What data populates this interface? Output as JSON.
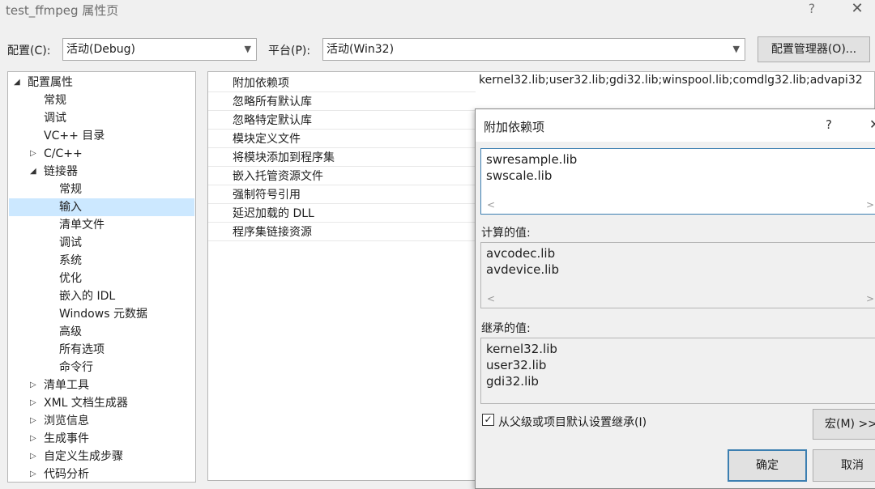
{
  "window": {
    "title": "test_ffmpeg 属性页",
    "help": "?",
    "close": "✕"
  },
  "toolbar": {
    "config_label": "配置(C):",
    "config_value": "活动(Debug)",
    "platform_label": "平台(P):",
    "platform_value": "活动(Win32)",
    "config_manager": "配置管理器(O)..."
  },
  "tree": {
    "items": [
      {
        "label": "配置属性",
        "twisty": "◢"
      },
      {
        "label": "常规"
      },
      {
        "label": "调试"
      },
      {
        "label": "VC++ 目录"
      },
      {
        "label": "C/C++",
        "twisty": "▷"
      },
      {
        "label": "链接器",
        "twisty": "◢"
      },
      {
        "label": "常规"
      },
      {
        "label": "输入"
      },
      {
        "label": "清单文件"
      },
      {
        "label": "调试"
      },
      {
        "label": "系统"
      },
      {
        "label": "优化"
      },
      {
        "label": "嵌入的 IDL"
      },
      {
        "label": "Windows 元数据"
      },
      {
        "label": "高级"
      },
      {
        "label": "所有选项"
      },
      {
        "label": "命令行"
      },
      {
        "label": "清单工具",
        "twisty": "▷"
      },
      {
        "label": "XML 文档生成器",
        "twisty": "▷"
      },
      {
        "label": "浏览信息",
        "twisty": "▷"
      },
      {
        "label": "生成事件",
        "twisty": "▷"
      },
      {
        "label": "自定义生成步骤",
        "twisty": "▷"
      },
      {
        "label": "代码分析",
        "twisty": "▷"
      }
    ]
  },
  "properties": {
    "rows": [
      "附加依赖项",
      "忽略所有默认库",
      "忽略特定默认库",
      "模块定义文件",
      "将模块添加到程序集",
      "嵌入托管资源文件",
      "强制符号引用",
      "延迟加载的 DLL",
      "程序集链接资源"
    ],
    "first_value": "kernel32.lib;user32.lib;gdi32.lib;winspool.lib;comdlg32.lib;advapi32"
  },
  "dialog": {
    "title": "附加依赖项",
    "help": "?",
    "close": "✕",
    "edit_lines": [
      "swresample.lib",
      "swscale.lib"
    ],
    "computed_label": "计算的值:",
    "computed_lines": [
      "avcodec.lib",
      "avdevice.lib"
    ],
    "inherited_label": "继承的值:",
    "inherited_lines": [
      "kernel32.lib",
      "user32.lib",
      "gdi32.lib"
    ],
    "inherit_checkbox": "从父级或项目默认设置继承(I)",
    "inherit_checked": "✓",
    "macro_button": "宏(M) >>",
    "ok_button": "确定",
    "cancel_button": "取消",
    "scroll_left": "<",
    "scroll_right": ">"
  }
}
